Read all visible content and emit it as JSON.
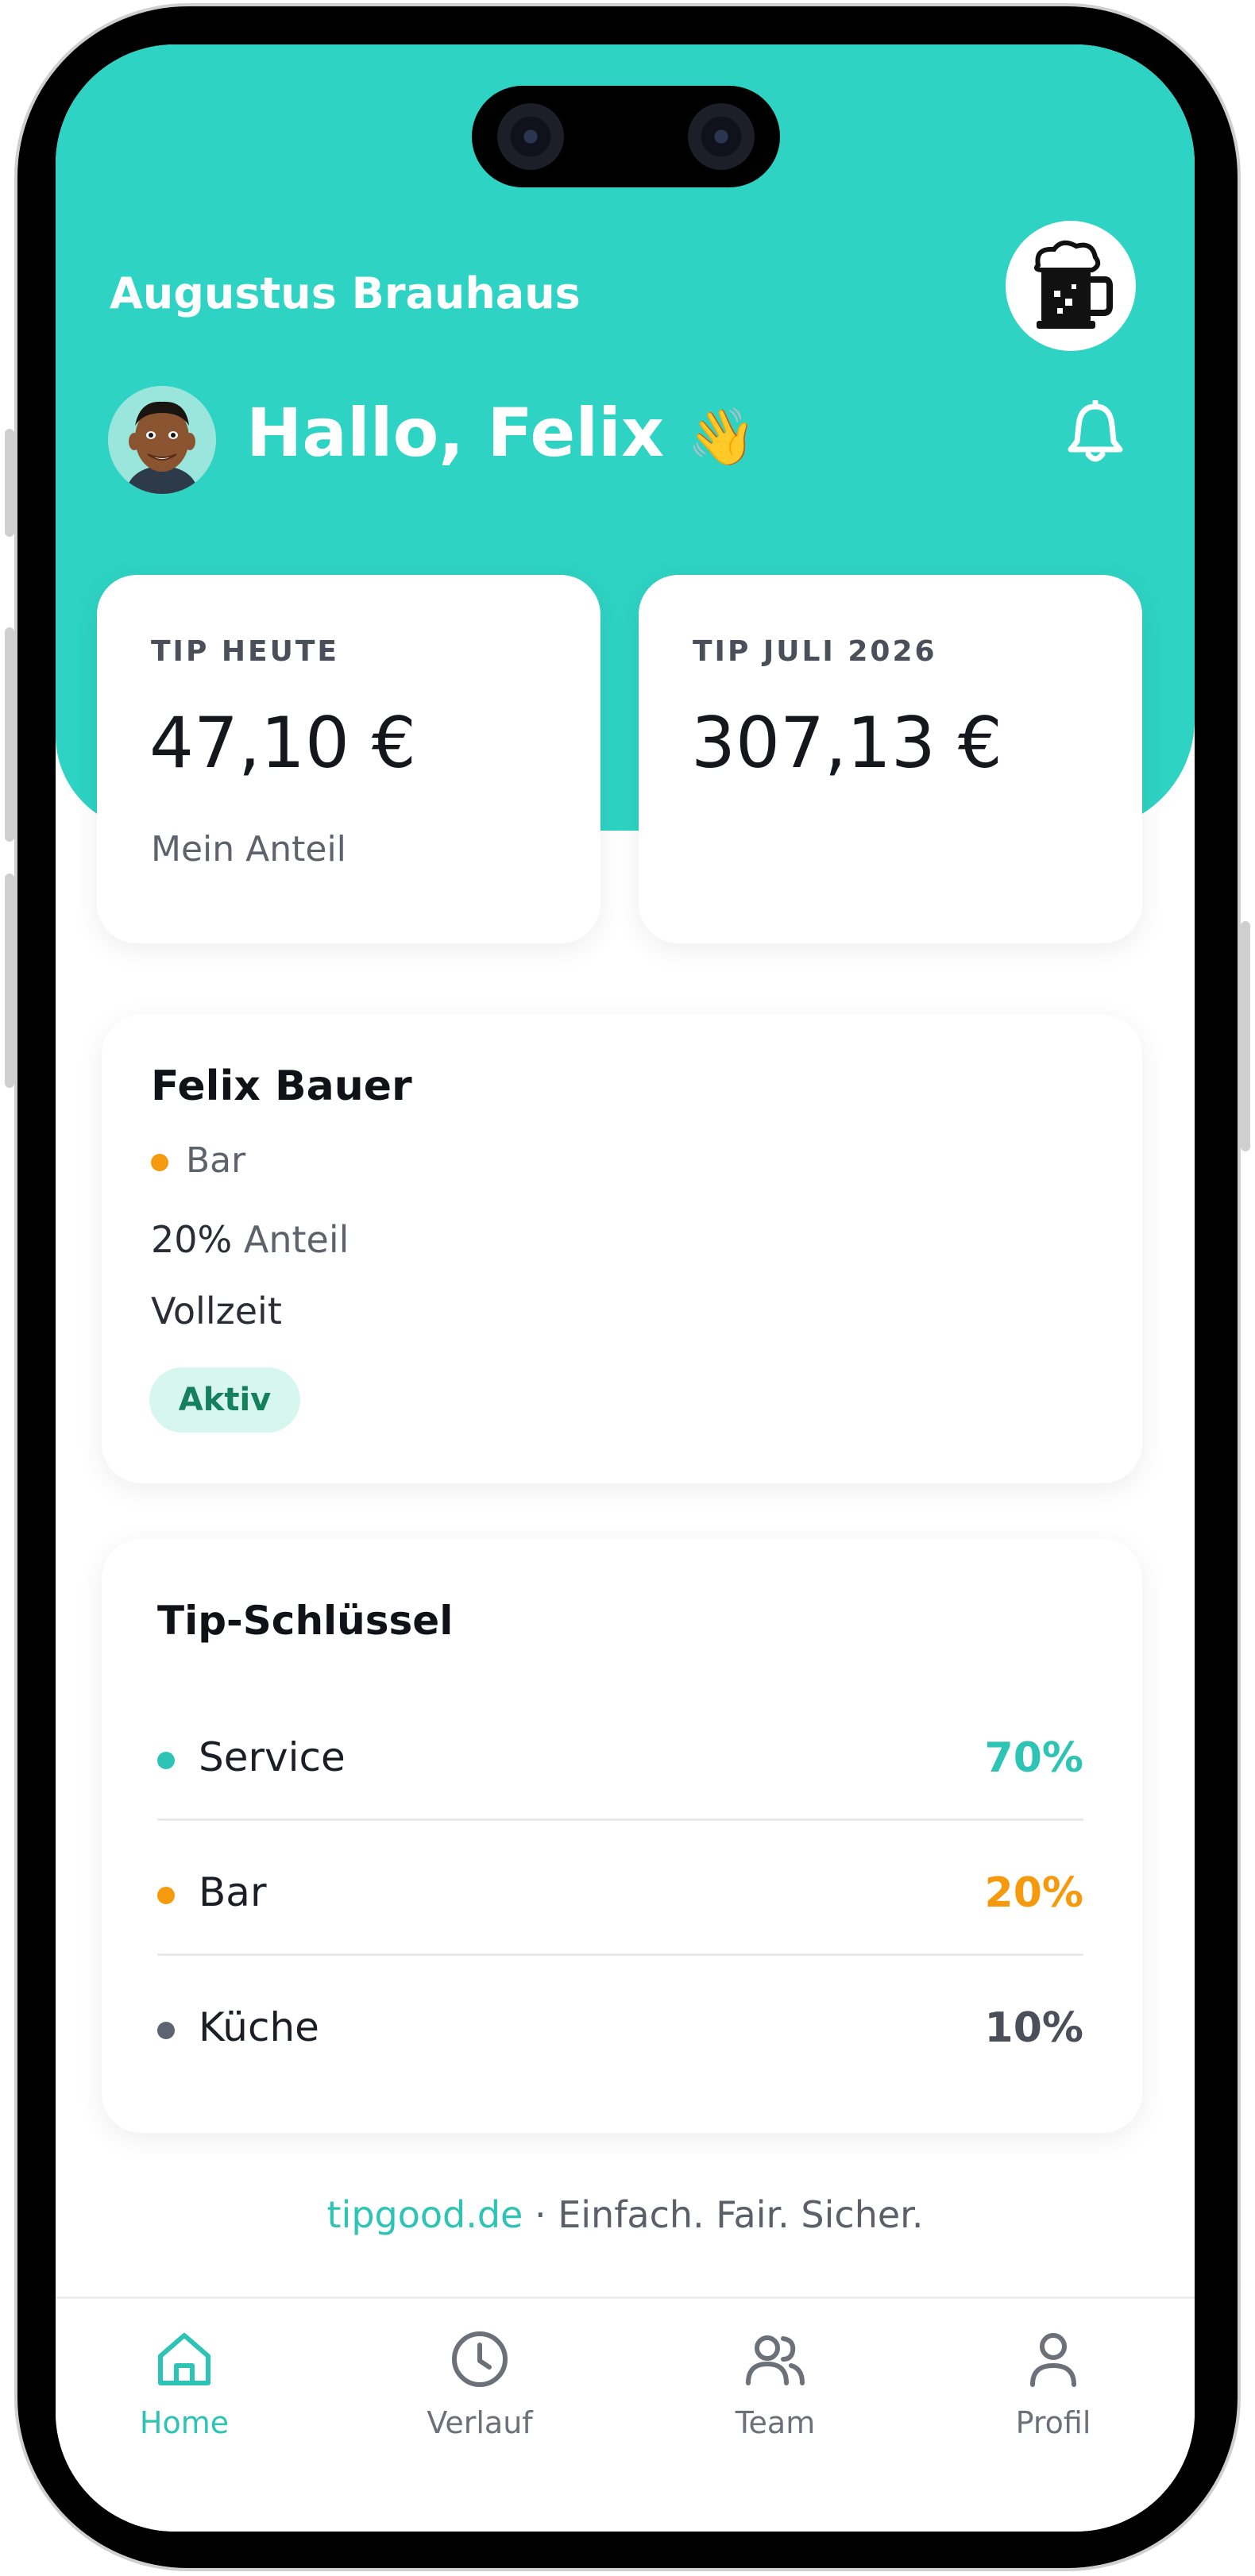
{
  "app": {
    "venue_name": "Augustus Brauhaus",
    "greeting": "Hallo, Felix",
    "greeting_emoji": "👋",
    "accent_color": "#2ed3c3"
  },
  "stats": [
    {
      "label": "TIP HEUTE",
      "value": "47,10 €",
      "sub": "Mein Anteil"
    },
    {
      "label": "TIP JULI 2026",
      "value": "307,13 €",
      "sub": ""
    }
  ],
  "employee": {
    "name": "Felix Bauer",
    "role": "Bar",
    "role_color": "#f59a0c",
    "share_pct": "20%",
    "share_label": "Anteil",
    "employment": "Vollzeit",
    "status": "Aktiv"
  },
  "tip_key": {
    "title": "Tip-Schlüssel",
    "rows": [
      {
        "name": "Service",
        "pct": "70%",
        "color": "#2ec4b5"
      },
      {
        "name": "Bar",
        "pct": "20%",
        "color": "#f59a0c"
      },
      {
        "name": "Küche",
        "pct": "10%",
        "color": "#5d6370"
      }
    ]
  },
  "footer": {
    "link": "tipgood.de",
    "tagline": " · Einfach. Fair. Sicher."
  },
  "tabs": [
    {
      "label": "Home",
      "icon": "home-icon",
      "active": true
    },
    {
      "label": "Verlauf",
      "icon": "clock-icon",
      "active": false
    },
    {
      "label": "Team",
      "icon": "users-icon",
      "active": false
    },
    {
      "label": "Profil",
      "icon": "user-icon",
      "active": false
    }
  ]
}
